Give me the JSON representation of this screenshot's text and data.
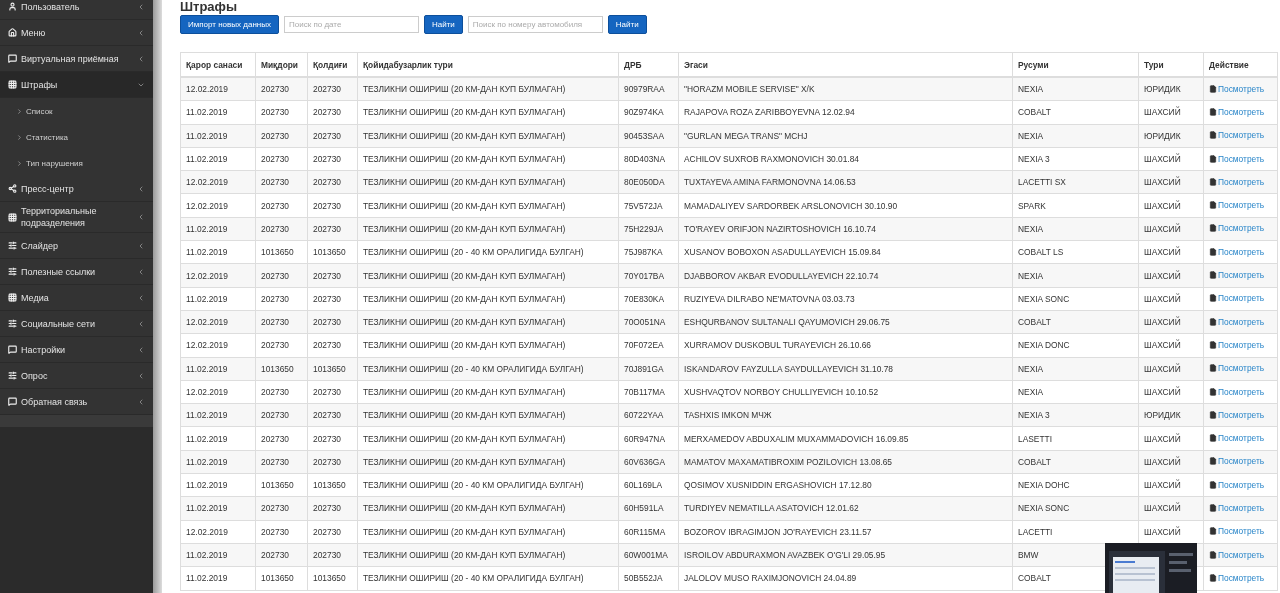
{
  "sidebar": {
    "items": [
      {
        "label": "Пользователь",
        "kind": "user",
        "expanded": false
      },
      {
        "label": "Меню",
        "kind": "home",
        "expanded": false
      },
      {
        "label": "Виртуальная приёмная",
        "kind": "chat",
        "expanded": false
      },
      {
        "label": "Штрафы",
        "kind": "grid",
        "expanded": true,
        "children": [
          {
            "label": "Список"
          },
          {
            "label": "Статистика"
          },
          {
            "label": "Тип нарушения"
          }
        ]
      },
      {
        "label": "Пресс-центр",
        "kind": "share",
        "expanded": false
      },
      {
        "label": "Территориальные подразделения",
        "kind": "grid",
        "expanded": false
      },
      {
        "label": "Слайдер",
        "kind": "sliders",
        "expanded": false
      },
      {
        "label": "Полезные ссылки",
        "kind": "sliders",
        "expanded": false
      },
      {
        "label": "Медиа",
        "kind": "grid",
        "expanded": false
      },
      {
        "label": "Социальные сети",
        "kind": "sliders",
        "expanded": false
      },
      {
        "label": "Настройки",
        "kind": "chat",
        "expanded": false
      },
      {
        "label": "Опрос",
        "kind": "sliders",
        "expanded": false
      },
      {
        "label": "Обратная связь",
        "kind": "chat",
        "expanded": false
      }
    ]
  },
  "page_title": "Штрафы",
  "toolbar": {
    "import_button": "Импорт новых данных",
    "date_search": {
      "placeholder": "Поиск по дате"
    },
    "date_button": "Найти",
    "plate_search": {
      "placeholder": "Поиск по номеру автомобиля"
    },
    "plate_button": "Найти"
  },
  "table": {
    "columns": [
      "Қарор санаси",
      "Миқдори",
      "Қолдиғи",
      "Қойидабузарлик тури",
      "ДРБ",
      "Эгаси",
      "Русуми",
      "Тури",
      "Действие"
    ],
    "rows": [
      [
        "12.02.2019",
        "202730",
        "202730",
        "ТЕЗЛИКНИ ОШИРИШ (20 КМ-ДАН КУП БУЛМАГАН)",
        "90979RAA",
        "\"HORAZM MOBILE SERVISE\" X/K",
        "NEXIA",
        "ЮРИДИК",
        "Посмотреть"
      ],
      [
        "11.02.2019",
        "202730",
        "202730",
        "ТЕЗЛИКНИ ОШИРИШ (20 КМ-ДАН КУП БУЛМАГАН)",
        "90Z974KA",
        "RAJAPOVA ROZA ZARIBBOYEVNA 12.02.94",
        "COBALT",
        "ШАХСИЙ",
        "Посмотреть"
      ],
      [
        "11.02.2019",
        "202730",
        "202730",
        "ТЕЗЛИКНИ ОШИРИШ (20 КМ-ДАН КУП БУЛМАГАН)",
        "90453SAA",
        "\"GURLAN MEGA TRANS\" MCHJ",
        "NEXIA",
        "ЮРИДИК",
        "Посмотреть"
      ],
      [
        "11.02.2019",
        "202730",
        "202730",
        "ТЕЗЛИКНИ ОШИРИШ (20 КМ-ДАН КУП БУЛМАГАН)",
        "80D403NA",
        "ACHILOV SUXROB RAXMONOVICH 30.01.84",
        "NEXIA 3",
        "ШАХСИЙ",
        "Посмотреть"
      ],
      [
        "12.02.2019",
        "202730",
        "202730",
        "ТЕЗЛИКНИ ОШИРИШ (20 КМ-ДАН КУП БУЛМАГАН)",
        "80E050DA",
        "TUXTAYEVA AMINA FARMONOVNA 14.06.53",
        "LACETTI SX",
        "ШАХСИЙ",
        "Посмотреть"
      ],
      [
        "12.02.2019",
        "202730",
        "202730",
        "ТЕЗЛИКНИ ОШИРИШ (20 КМ-ДАН КУП БУЛМАГАН)",
        "75V572JA",
        "MAMADALIYEV SARDORBEK ARSLONOVICH 30.10.90",
        "SPARK",
        "ШАХСИЙ",
        "Посмотреть"
      ],
      [
        "11.02.2019",
        "202730",
        "202730",
        "ТЕЗЛИКНИ ОШИРИШ (20 КМ-ДАН КУП БУЛМАГАН)",
        "75H229JA",
        "TO'RAYEV ORIFJON NAZIRTOSHOVICH 16.10.74",
        "NEXIA",
        "ШАХСИЙ",
        "Посмотреть"
      ],
      [
        "11.02.2019",
        "1013650",
        "1013650",
        "ТЕЗЛИКНИ ОШИРИШ (20 - 40 КМ ОРАЛИГИДА БУЛГАН)",
        "75J987KA",
        "XUSANOV BOBOXON ASADULLAYEVICH 15.09.84",
        "COBALT LS",
        "ШАХСИЙ",
        "Посмотреть"
      ],
      [
        "12.02.2019",
        "202730",
        "202730",
        "ТЕЗЛИКНИ ОШИРИШ (20 КМ-ДАН КУП БУЛМАГАН)",
        "70Y017BA",
        "DJABBOROV AKBAR EVODULLAYEVICH 22.10.74",
        "NEXIA",
        "ШАХСИЙ",
        "Посмотреть"
      ],
      [
        "11.02.2019",
        "202730",
        "202730",
        "ТЕЗЛИКНИ ОШИРИШ (20 КМ-ДАН КУП БУЛМАГАН)",
        "70E830KA",
        "RUZIYEVA DILRABO NE'MATOVNA 03.03.73",
        "NEXIA SONC",
        "ШАХСИЙ",
        "Посмотреть"
      ],
      [
        "12.02.2019",
        "202730",
        "202730",
        "ТЕЗЛИКНИ ОШИРИШ (20 КМ-ДАН КУП БУЛМАГАН)",
        "70O051NA",
        "ESHQURBANOV SULTANALI QAYUMOVICH 29.06.75",
        "COBALT",
        "ШАХСИЙ",
        "Посмотреть"
      ],
      [
        "12.02.2019",
        "202730",
        "202730",
        "ТЕЗЛИКНИ ОШИРИШ (20 КМ-ДАН КУП БУЛМАГАН)",
        "70F072EA",
        "XURRAMOV DUSKOBUL TURAYEVICH 26.10.66",
        "NEXIA DONC",
        "ШАХСИЙ",
        "Посмотреть"
      ],
      [
        "11.02.2019",
        "1013650",
        "1013650",
        "ТЕЗЛИКНИ ОШИРИШ (20 - 40 КМ ОРАЛИГИДА БУЛГАН)",
        "70J891GA",
        "ISKANDAROV FAYZULLA SAYDULLAYEVICH 31.10.78",
        "NEXIA",
        "ШАХСИЙ",
        "Посмотреть"
      ],
      [
        "12.02.2019",
        "202730",
        "202730",
        "ТЕЗЛИКНИ ОШИРИШ (20 КМ-ДАН КУП БУЛМАГАН)",
        "70B117MA",
        "XUSHVAQTOV NORBOY CHULLIYEVICH 10.10.52",
        "NEXIA",
        "ШАХСИЙ",
        "Посмотреть"
      ],
      [
        "11.02.2019",
        "202730",
        "202730",
        "ТЕЗЛИКНИ ОШИРИШ (20 КМ-ДАН КУП БУЛМАГАН)",
        "60722YAA",
        "TASHXIS IMKON МЧЖ",
        "NEXIA 3",
        "ЮРИДИК",
        "Посмотреть"
      ],
      [
        "11.02.2019",
        "202730",
        "202730",
        "ТЕЗЛИКНИ ОШИРИШ (20 КМ-ДАН КУП БУЛМАГАН)",
        "60R947NA",
        "MERXAMEDOV ABDUXALIM MUXAMMADOVICH 16.09.85",
        "LASETTI",
        "ШАХСИЙ",
        "Посмотреть"
      ],
      [
        "11.02.2019",
        "202730",
        "202730",
        "ТЕЗЛИКНИ ОШИРИШ (20 КМ-ДАН КУП БУЛМАГАН)",
        "60V636GA",
        "MAMATOV MAXAMATIBROXIM POZILOVICH 13.08.65",
        "COBALT",
        "ШАХСИЙ",
        "Посмотреть"
      ],
      [
        "11.02.2019",
        "1013650",
        "1013650",
        "ТЕЗЛИКНИ ОШИРИШ (20 - 40 КМ ОРАЛИГИДА БУЛГАН)",
        "60L169LA",
        "QOSIMOV XUSNIDDIN ERGASHOVICH 17.12.80",
        "NEXIA DOHC",
        "ШАХСИЙ",
        "Посмотреть"
      ],
      [
        "11.02.2019",
        "202730",
        "202730",
        "ТЕЗЛИКНИ ОШИРИШ (20 КМ-ДАН КУП БУЛМАГАН)",
        "60H591LA",
        "TURDIYEV NEMATILLA ASATOVICH 12.01.62",
        "NEXIA SONC",
        "ШАХСИЙ",
        "Посмотреть"
      ],
      [
        "12.02.2019",
        "202730",
        "202730",
        "ТЕЗЛИКНИ ОШИРИШ (20 КМ-ДАН КУП БУЛМАГАН)",
        "60R115MA",
        "BOZOROV IBRAGIMJON JO'RAYEVICH 23.11.57",
        "LACETTI",
        "ШАХСИЙ",
        "Посмотреть"
      ],
      [
        "11.02.2019",
        "202730",
        "202730",
        "ТЕЗЛИКНИ ОШИРИШ (20 КМ-ДАН КУП БУЛМАГАН)",
        "60W001MA",
        "ISROILOV ABDURAXMON AVAZBEK O'G'LI 29.05.95",
        "BMW",
        null,
        "Посмотреть"
      ],
      [
        "11.02.2019",
        "1013650",
        "1013650",
        "ТЕЗЛИКНИ ОШИРИШ (20 - 40 КМ ОРАЛИГИДА БУЛГАН)",
        "50B552JA",
        "JALOLOV MUSO RAXIMJONOVICH 24.04.89",
        "COBALT",
        null,
        "Посмотреть"
      ]
    ]
  }
}
